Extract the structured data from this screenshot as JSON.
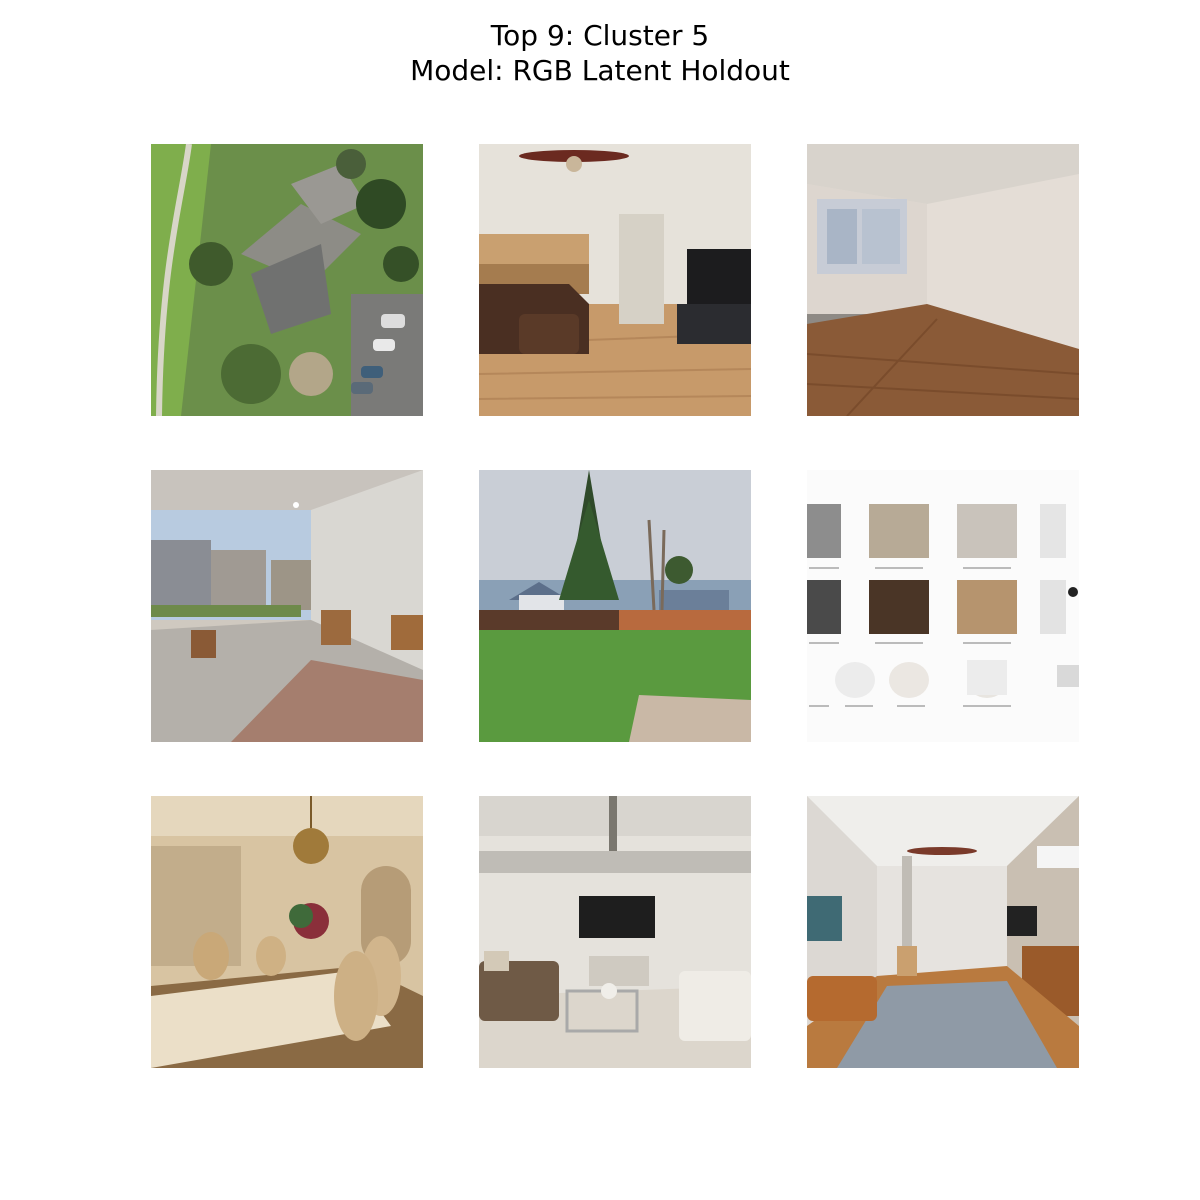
{
  "figure": {
    "title_line1": "Top 9: Cluster 5",
    "title_line2": "Model: RGB Latent Holdout"
  },
  "images": [
    {
      "subject": "aerial view of condo buildings, trees and parking lot"
    },
    {
      "subject": "living room with leather sofa, TV and ceiling fan, open kitchen"
    },
    {
      "subject": "empty room with wood floor, window and baseboard heater"
    },
    {
      "subject": "covered patio with outdoor furniture and rug"
    },
    {
      "subject": "backyard lawn with tall evergreen tree and wooden fence"
    },
    {
      "subject": "finish selection board with carpet, flooring and door swatches"
    },
    {
      "subject": "dining room with chandelier, table and upholstered chairs"
    },
    {
      "subject": "loft living room with wall-mounted TV, sofas and glass coffee table"
    },
    {
      "subject": "long living room with ceiling fan, leather sofa and area rug"
    }
  ]
}
